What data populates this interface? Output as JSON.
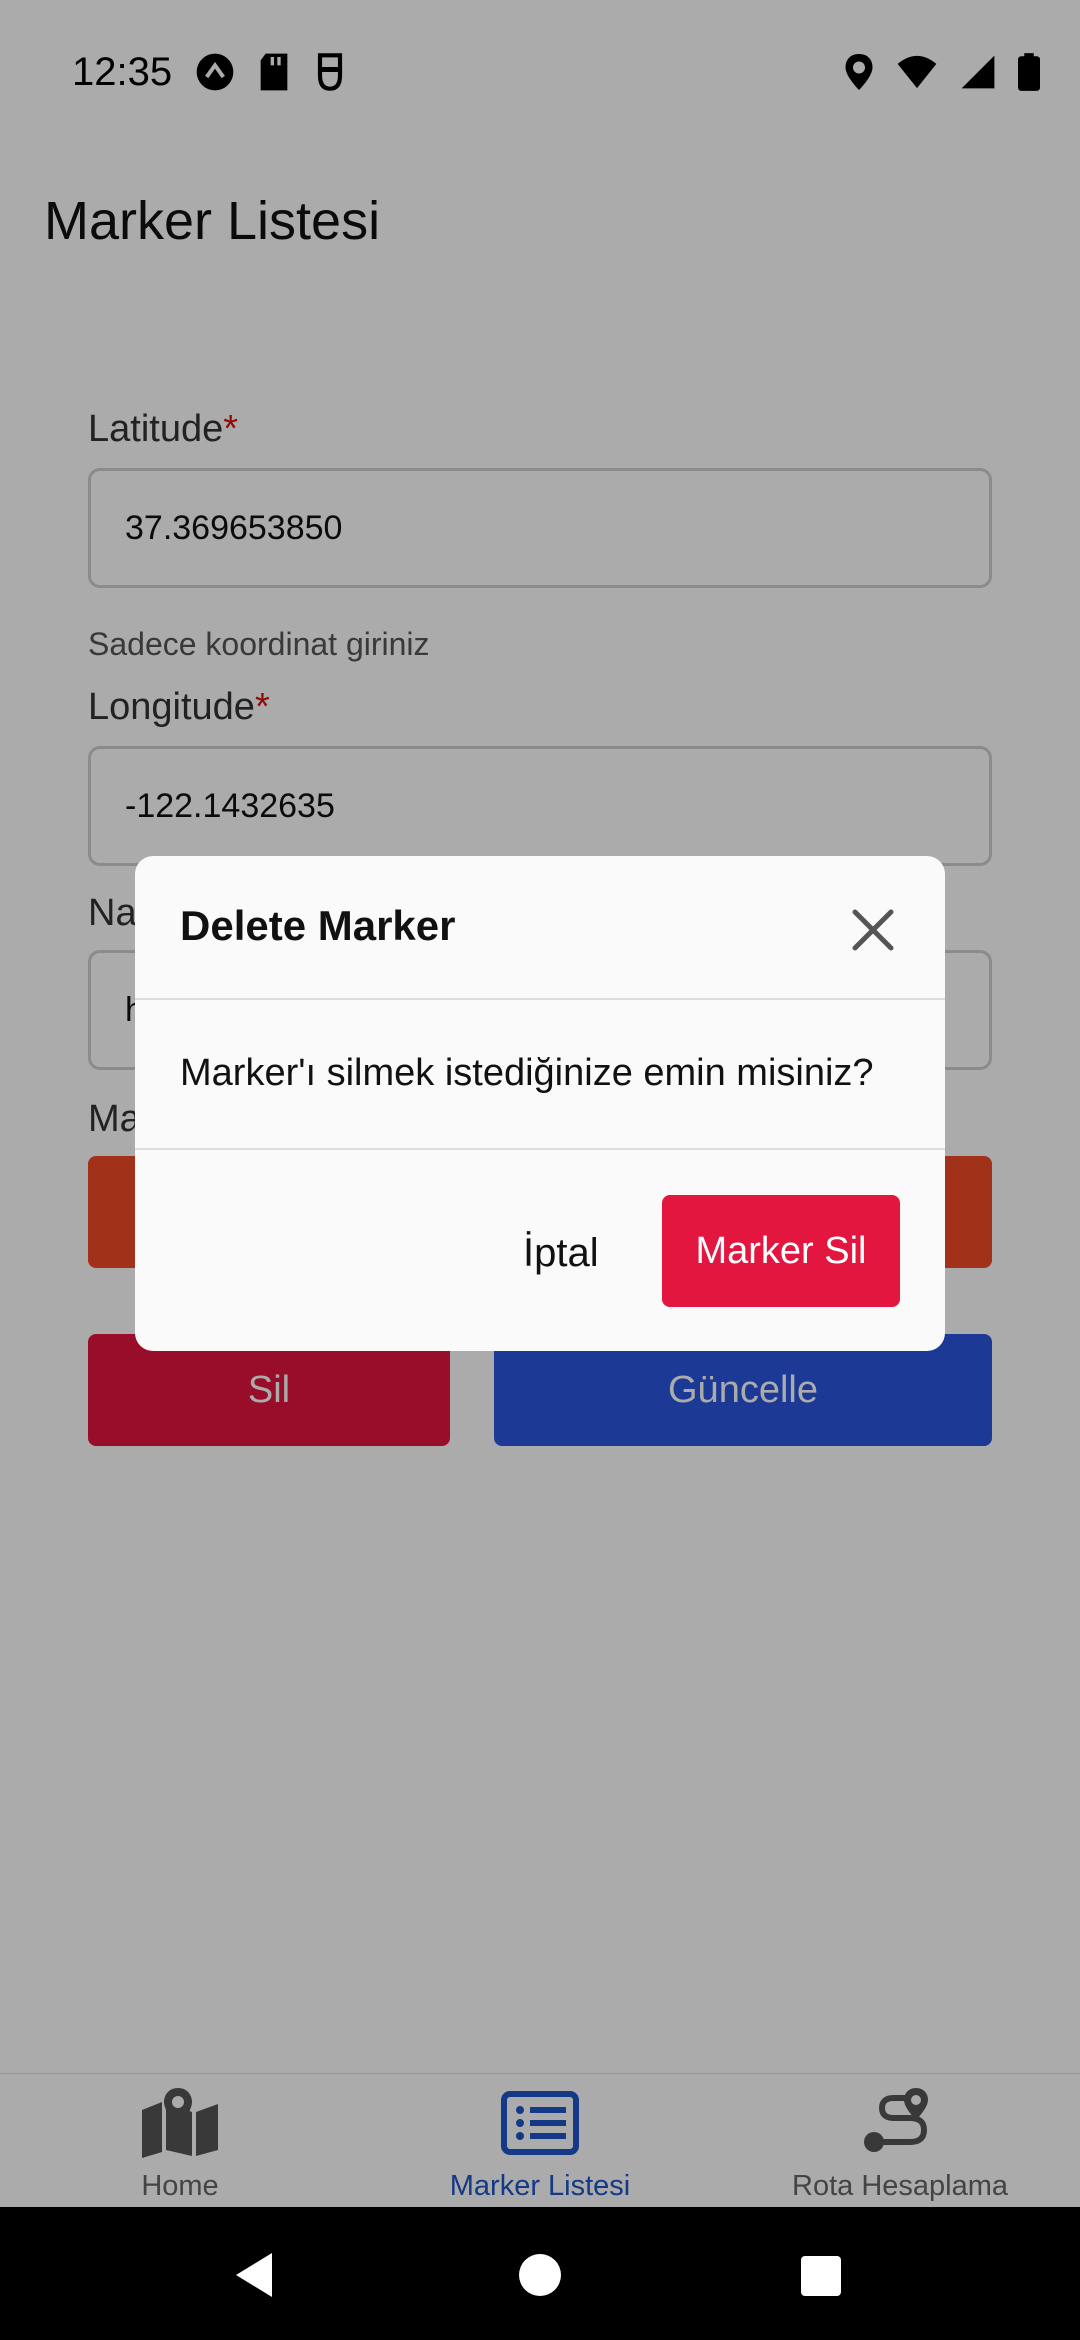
{
  "status_bar": {
    "time": "12:35",
    "left_icons": [
      "cloud-up-icon",
      "sd-card-icon",
      "shield-icon"
    ],
    "right_icons": [
      "location-icon",
      "wifi-icon",
      "signal-icon",
      "battery-icon"
    ]
  },
  "app_bar": {
    "title": "Marker Listesi"
  },
  "form": {
    "latitude": {
      "label": "Latitude",
      "required_mark": "*",
      "value": "37.369653850",
      "helper": "Sadece koordinat giriniz"
    },
    "longitude": {
      "label": "Longitude",
      "required_mark": "*",
      "value": "-122.1432635"
    },
    "name": {
      "label_partial": "Na",
      "value_partial": "h"
    },
    "marker_color": {
      "label_partial": "Ma"
    }
  },
  "actions": {
    "delete_label": "Sil",
    "update_label": "Güncelle"
  },
  "dialog": {
    "title": "Delete Marker",
    "message": "Marker'ı silmek istediğinize emin misiniz?",
    "cancel_label": "İptal",
    "confirm_label": "Marker Sil"
  },
  "bottom_nav": {
    "items": [
      {
        "label": "Home",
        "icon": "map-icon",
        "active": false
      },
      {
        "label": "Marker Listesi",
        "icon": "list-icon",
        "active": true
      },
      {
        "label": "Rota Hesaplama",
        "icon": "route-icon",
        "active": false
      }
    ]
  },
  "colors": {
    "accent_red": "#e3163f",
    "accent_blue": "#2a55e0",
    "accent_orange": "#f04a25",
    "active_nav": "#1f55c8"
  }
}
